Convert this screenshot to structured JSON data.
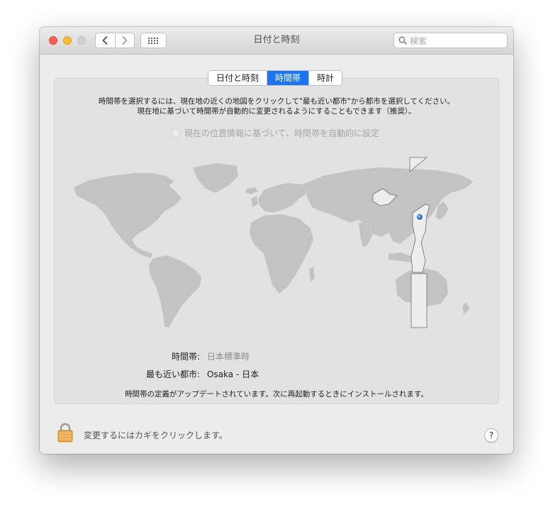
{
  "window": {
    "title": "日付と時刻",
    "search_placeholder": "検索"
  },
  "tabs": [
    {
      "label": "日付と時刻",
      "active": false
    },
    {
      "label": "時間帯",
      "active": true
    },
    {
      "label": "時計",
      "active": false
    }
  ],
  "instructions": {
    "line1": "時間帯を選択するには、現在地の近くの地図をクリックして\"最も近い都市\"から都市を選択してください。",
    "line2": "現在地に基づいて時間帯が自動的に変更されるようにすることもできます（推奨）。"
  },
  "auto_timezone": {
    "label": "現在の位置情報に基づいて、時間帯を自動的に設定",
    "checked": false,
    "enabled": false
  },
  "timezone": {
    "label": "時間帯:",
    "value": "日本標準時"
  },
  "closest_city": {
    "label": "最も近い都市:",
    "value": "Osaka - 日本"
  },
  "notice": "時間帯の定義がアップデートされています。次に再起動するときにインストールされます。",
  "lock": {
    "text": "変更するにはカギをクリックします。"
  },
  "help_label": "?",
  "colors": {
    "accent": "#1b74f5",
    "land": "#c3c3c3",
    "selected_zone": "#ededed",
    "city_pin": "#2a7ee6"
  },
  "icons": {
    "back": "chevron-left-icon",
    "forward": "chevron-right-icon",
    "show_all": "grid-icon",
    "search": "magnifier-icon",
    "lock": "padlock-icon",
    "help": "question-icon"
  }
}
